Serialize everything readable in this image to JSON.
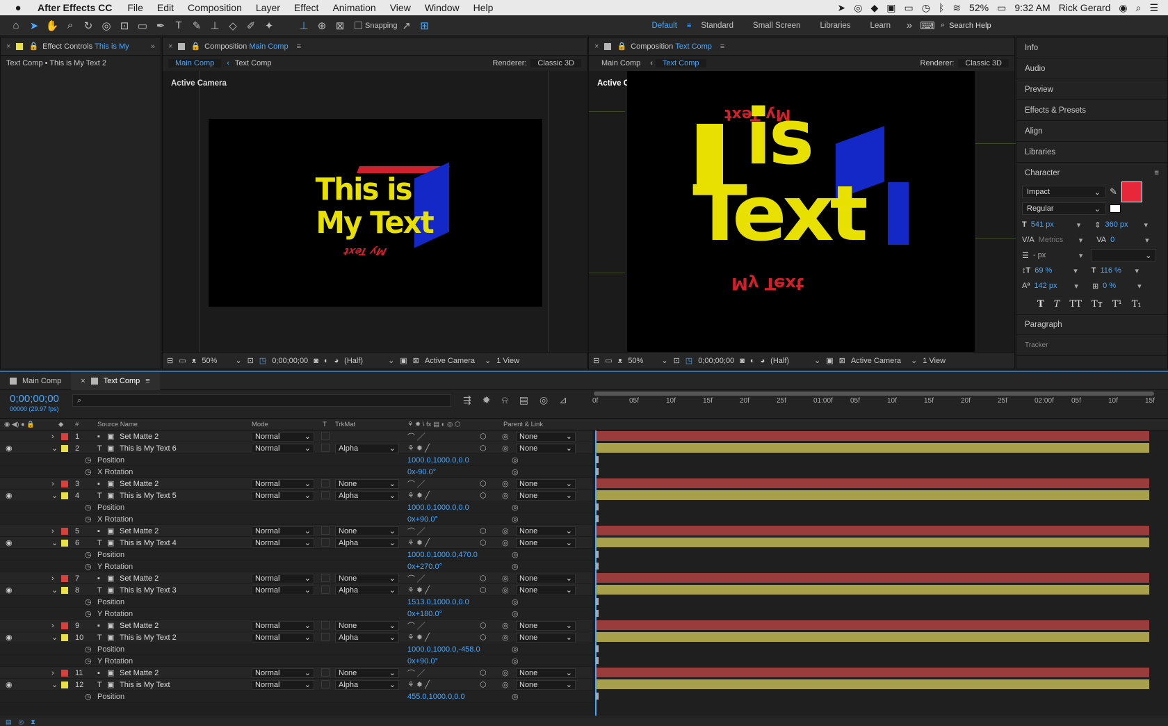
{
  "menubar": {
    "app": "After Effects CC",
    "items": [
      "File",
      "Edit",
      "Composition",
      "Layer",
      "Effect",
      "Animation",
      "View",
      "Window",
      "Help"
    ],
    "battery": "52%",
    "time": "9:32 AM",
    "user": "Rick Gerard"
  },
  "toolbar": {
    "snapping": "Snapping",
    "workspaces": [
      "Default",
      "Standard",
      "Small Screen",
      "Libraries",
      "Learn"
    ],
    "search": "Search Help"
  },
  "effect_controls": {
    "tab_prefix": "Effect Controls",
    "tab_layer": "This is  My",
    "subtitle": "Text Comp • This is  My Text 2"
  },
  "main_viewer": {
    "tab_prefix": "Composition",
    "tab_comp": "Main Comp",
    "breadcrumb_1": "Main Comp",
    "breadcrumb_2": "Text Comp",
    "renderer_label": "Renderer:",
    "renderer": "Classic 3D",
    "camera_label": "Active Camera",
    "zoom": "50%",
    "timecode": "0;00;00;00",
    "resolution": "(Half)",
    "view_camera": "Active Camera",
    "views": "1 View"
  },
  "text_viewer": {
    "tab_prefix": "Composition",
    "tab_comp": "Text Comp",
    "breadcrumb_1": "Main Comp",
    "breadcrumb_2": "Text Comp",
    "renderer_label": "Renderer:",
    "renderer": "Classic 3D",
    "camera_label": "Active Camera",
    "zoom": "50%",
    "timecode": "0;00;00;00",
    "resolution": "(Half)",
    "view_camera": "Active Camera",
    "views": "1 View"
  },
  "right_panels": [
    "Info",
    "Audio",
    "Preview",
    "Effects & Presets",
    "Align",
    "Libraries"
  ],
  "character": {
    "title": "Character",
    "font": "Impact",
    "style": "Regular",
    "size": "541 px",
    "leading": "360 px",
    "kerning": "Metrics",
    "tracking": "0",
    "stroke": "- px",
    "vscale": "69 %",
    "hscale": "116 %",
    "baseline": "142 px",
    "tsume": "0 %",
    "fill_color": "#e8283a",
    "styles": [
      "T",
      "T",
      "TT",
      "Tт",
      "T¹",
      "T₁"
    ]
  },
  "paragraph": {
    "title": "Paragraph",
    "tracker": "Tracker"
  },
  "timeline": {
    "tabs": [
      "Main Comp",
      "Text Comp"
    ],
    "timecode": "0;00;00;00",
    "frame_info": "00000 (29.97 fps)",
    "headers": {
      "num": "#",
      "source": "Source Name",
      "mode": "Mode",
      "t": "T",
      "trkmat": "TrkMat",
      "parent": "Parent & Link"
    },
    "ruler": [
      "0f",
      "05f",
      "10f",
      "15f",
      "20f",
      "25f",
      "01:00f",
      "05f",
      "10f",
      "15f",
      "20f",
      "25f",
      "02:00f",
      "05f",
      "10f",
      "15f"
    ],
    "rows": [
      {
        "kind": "layer",
        "num": "1",
        "name": "Set Matte 2",
        "color": "#d6413d",
        "mode": "Normal",
        "trkmat": "",
        "parent": "None",
        "eye": false,
        "open": false
      },
      {
        "kind": "layer",
        "num": "2",
        "name": "This is  My Text 6",
        "color": "#e8e048",
        "mode": "Normal",
        "trkmat": "Alpha",
        "parent": "None",
        "eye": true,
        "open": true
      },
      {
        "kind": "prop",
        "name": "Position",
        "value": "1000.0,1000.0,0.0"
      },
      {
        "kind": "prop",
        "name": "X Rotation",
        "value": "0x-90.0°"
      },
      {
        "kind": "layer",
        "num": "3",
        "name": "Set Matte 2",
        "color": "#d6413d",
        "mode": "Normal",
        "trkmat": "None",
        "parent": "None",
        "eye": false,
        "open": false
      },
      {
        "kind": "layer",
        "num": "4",
        "name": "This is  My Text 5",
        "color": "#e8e048",
        "mode": "Normal",
        "trkmat": "Alpha",
        "parent": "None",
        "eye": true,
        "open": true
      },
      {
        "kind": "prop",
        "name": "Position",
        "value": "1000.0,1000.0,0.0"
      },
      {
        "kind": "prop",
        "name": "X Rotation",
        "value": "0x+90.0°"
      },
      {
        "kind": "layer",
        "num": "5",
        "name": "Set Matte 2",
        "color": "#d6413d",
        "mode": "Normal",
        "trkmat": "None",
        "parent": "None",
        "eye": false,
        "open": false
      },
      {
        "kind": "layer",
        "num": "6",
        "name": "This is  My Text 4",
        "color": "#e8e048",
        "mode": "Normal",
        "trkmat": "Alpha",
        "parent": "None",
        "eye": true,
        "open": true
      },
      {
        "kind": "prop",
        "name": "Position",
        "value": "1000.0,1000.0,470.0"
      },
      {
        "kind": "prop",
        "name": "Y Rotation",
        "value": "0x+270.0°"
      },
      {
        "kind": "layer",
        "num": "7",
        "name": "Set Matte 2",
        "color": "#d6413d",
        "mode": "Normal",
        "trkmat": "None",
        "parent": "None",
        "eye": false,
        "open": false
      },
      {
        "kind": "layer",
        "num": "8",
        "name": "This is  My Text 3",
        "color": "#e8e048",
        "mode": "Normal",
        "trkmat": "Alpha",
        "parent": "None",
        "eye": true,
        "open": true
      },
      {
        "kind": "prop",
        "name": "Position",
        "value": "1513.0,1000.0,0.0"
      },
      {
        "kind": "prop",
        "name": "Y Rotation",
        "value": "0x+180.0°"
      },
      {
        "kind": "layer",
        "num": "9",
        "name": "Set Matte 2",
        "color": "#d6413d",
        "mode": "Normal",
        "trkmat": "None",
        "parent": "None",
        "eye": false,
        "open": false
      },
      {
        "kind": "layer",
        "num": "10",
        "name": "This is  My Text 2",
        "color": "#e8e048",
        "mode": "Normal",
        "trkmat": "Alpha",
        "parent": "None",
        "eye": true,
        "open": true
      },
      {
        "kind": "prop",
        "name": "Position",
        "value": "1000.0,1000.0,-458.0"
      },
      {
        "kind": "prop",
        "name": "Y Rotation",
        "value": "0x+90.0°"
      },
      {
        "kind": "layer",
        "num": "11",
        "name": "Set Matte 2",
        "color": "#d6413d",
        "mode": "Normal",
        "trkmat": "None",
        "parent": "None",
        "eye": false,
        "open": false
      },
      {
        "kind": "layer",
        "num": "12",
        "name": "This is  My Text",
        "color": "#e8e048",
        "mode": "Normal",
        "trkmat": "Alpha",
        "parent": "None",
        "eye": true,
        "open": true
      },
      {
        "kind": "prop",
        "name": "Position",
        "value": "455.0,1000.0,0.0"
      }
    ]
  },
  "art": {
    "cube_front_1": "This is",
    "cube_front_2": "My Text",
    "big_1": "is",
    "big_2": "Text",
    "mirror": "My Text"
  }
}
